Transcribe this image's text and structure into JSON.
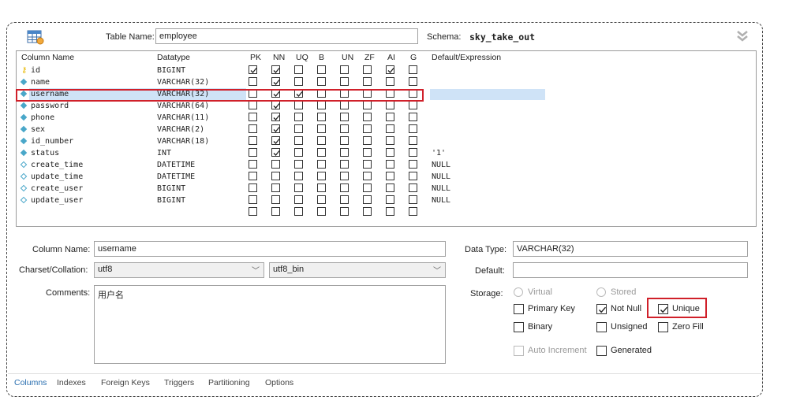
{
  "header": {
    "table_name_label": "Table Name:",
    "table_name_value": "employee",
    "schema_label": "Schema:",
    "schema_value": "sky_take_out"
  },
  "grid": {
    "columns": [
      "Column Name",
      "Datatype",
      "PK",
      "NN",
      "UQ",
      "B",
      "UN",
      "ZF",
      "AI",
      "G",
      "Default/Expression"
    ],
    "rows": [
      {
        "name": "id",
        "type": "BIGINT",
        "pk": true,
        "nn": true,
        "uq": false,
        "b": false,
        "un": false,
        "zf": false,
        "ai": true,
        "g": false,
        "default": "",
        "icon": "key-icon"
      },
      {
        "name": "name",
        "type": "VARCHAR(32)",
        "pk": false,
        "nn": true,
        "uq": false,
        "b": false,
        "un": false,
        "zf": false,
        "ai": false,
        "g": false,
        "default": "",
        "icon": "filled-diamond"
      },
      {
        "name": "username",
        "type": "VARCHAR(32)",
        "pk": false,
        "nn": true,
        "uq": true,
        "b": false,
        "un": false,
        "zf": false,
        "ai": false,
        "g": false,
        "default": "",
        "icon": "filled-diamond",
        "selected": true
      },
      {
        "name": "password",
        "type": "VARCHAR(64)",
        "pk": false,
        "nn": true,
        "uq": false,
        "b": false,
        "un": false,
        "zf": false,
        "ai": false,
        "g": false,
        "default": "",
        "icon": "filled-diamond"
      },
      {
        "name": "phone",
        "type": "VARCHAR(11)",
        "pk": false,
        "nn": true,
        "uq": false,
        "b": false,
        "un": false,
        "zf": false,
        "ai": false,
        "g": false,
        "default": "",
        "icon": "filled-diamond"
      },
      {
        "name": "sex",
        "type": "VARCHAR(2)",
        "pk": false,
        "nn": true,
        "uq": false,
        "b": false,
        "un": false,
        "zf": false,
        "ai": false,
        "g": false,
        "default": "",
        "icon": "filled-diamond"
      },
      {
        "name": "id_number",
        "type": "VARCHAR(18)",
        "pk": false,
        "nn": true,
        "uq": false,
        "b": false,
        "un": false,
        "zf": false,
        "ai": false,
        "g": false,
        "default": "",
        "icon": "filled-diamond"
      },
      {
        "name": "status",
        "type": "INT",
        "pk": false,
        "nn": true,
        "uq": false,
        "b": false,
        "un": false,
        "zf": false,
        "ai": false,
        "g": false,
        "default": "'1'",
        "icon": "filled-diamond"
      },
      {
        "name": "create_time",
        "type": "DATETIME",
        "pk": false,
        "nn": false,
        "uq": false,
        "b": false,
        "un": false,
        "zf": false,
        "ai": false,
        "g": false,
        "default": "NULL",
        "icon": "hollow-diamond"
      },
      {
        "name": "update_time",
        "type": "DATETIME",
        "pk": false,
        "nn": false,
        "uq": false,
        "b": false,
        "un": false,
        "zf": false,
        "ai": false,
        "g": false,
        "default": "NULL",
        "icon": "hollow-diamond"
      },
      {
        "name": "create_user",
        "type": "BIGINT",
        "pk": false,
        "nn": false,
        "uq": false,
        "b": false,
        "un": false,
        "zf": false,
        "ai": false,
        "g": false,
        "default": "NULL",
        "icon": "hollow-diamond"
      },
      {
        "name": "update_user",
        "type": "BIGINT",
        "pk": false,
        "nn": false,
        "uq": false,
        "b": false,
        "un": false,
        "zf": false,
        "ai": false,
        "g": false,
        "default": "NULL",
        "icon": "hollow-diamond"
      }
    ]
  },
  "details": {
    "column_name_label": "Column Name:",
    "column_name_value": "username",
    "charset_label": "Charset/Collation:",
    "charset_value": "utf8",
    "collation_value": "utf8_bin",
    "comments_label": "Comments:",
    "comments_value": "用户名",
    "data_type_label": "Data Type:",
    "data_type_value": "VARCHAR(32)",
    "default_label": "Default:",
    "default_value": "",
    "storage_label": "Storage:",
    "virtual_label": "Virtual",
    "stored_label": "Stored",
    "primary_key_label": "Primary Key",
    "not_null_label": "Not Null",
    "unique_label": "Unique",
    "binary_label": "Binary",
    "unsigned_label": "Unsigned",
    "zero_fill_label": "Zero Fill",
    "auto_increment_label": "Auto Increment",
    "generated_label": "Generated"
  },
  "tabs": [
    "Columns",
    "Indexes",
    "Foreign Keys",
    "Triggers",
    "Partitioning",
    "Options"
  ],
  "colors": {
    "selection": "#cfe3f7",
    "highlight_border": "#d0202a",
    "key": "#e8b800",
    "diamond": "#49a7c9",
    "active_tab": "#2a6fb0"
  }
}
